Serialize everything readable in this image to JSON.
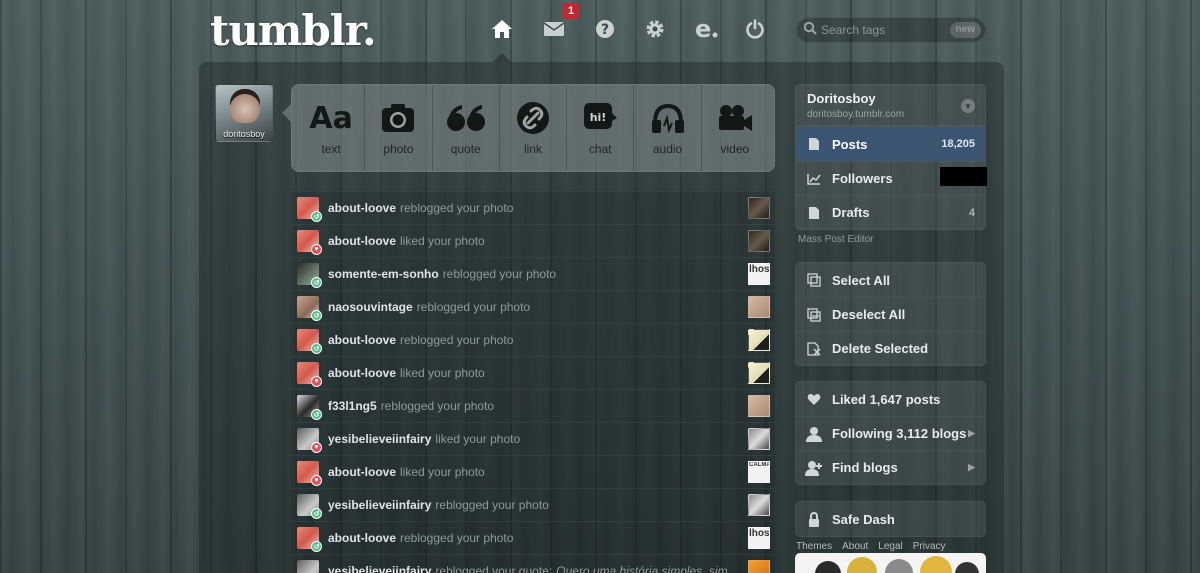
{
  "header": {
    "logo": "tumblr.",
    "mail_badge": "1",
    "search": {
      "placeholder": "Search tags",
      "new_label": "new"
    },
    "nav_icons": [
      "home-icon",
      "mail-icon",
      "help-icon",
      "gear-icon",
      "e-icon",
      "power-icon"
    ]
  },
  "profile": {
    "avatar_caption": "doritosboy"
  },
  "post_types": [
    {
      "label": "text",
      "glyph": "Aa"
    },
    {
      "label": "photo"
    },
    {
      "label": "quote",
      "glyph": "66"
    },
    {
      "label": "link"
    },
    {
      "label": "chat",
      "glyph": "hi!"
    },
    {
      "label": "audio"
    },
    {
      "label": "video"
    }
  ],
  "activity": [
    {
      "user": "about-loove",
      "action": "reblogged your photo",
      "type": "reblog"
    },
    {
      "user": "about-loove",
      "action": "liked your photo",
      "type": "like"
    },
    {
      "user": "somente-em-sonho",
      "action": "reblogged your photo",
      "type": "reblog",
      "thumb_text": "lhos"
    },
    {
      "user": "naosouvintage",
      "action": "reblogged your photo",
      "type": "reblog"
    },
    {
      "user": "about-loove",
      "action": "reblogged your photo",
      "type": "reblog"
    },
    {
      "user": "about-loove",
      "action": "liked your photo",
      "type": "like"
    },
    {
      "user": "f33l1ng5",
      "action": "reblogged your photo",
      "type": "reblog"
    },
    {
      "user": "yesibelieveiinfairy",
      "action": "liked your photo",
      "type": "like"
    },
    {
      "user": "about-loove",
      "action": "liked your photo",
      "type": "like",
      "thumb_text": "CALMA"
    },
    {
      "user": "yesibelieveiinfairy",
      "action": "reblogged your photo",
      "type": "reblog"
    },
    {
      "user": "about-loove",
      "action": "reblogged your photo",
      "type": "reblog",
      "thumb_text": "lhos"
    },
    {
      "user": "yesibelieveiinfairy",
      "action": "reblogged your quote:",
      "quote": "Quero uma história simples, sim",
      "type": "reblog"
    }
  ],
  "sidebar": {
    "blog": {
      "name": "Doritosboy",
      "url": "doritosboy.tumblr.com"
    },
    "stats": [
      {
        "label": "Posts",
        "count": "18,205",
        "icon": "document-icon",
        "active": true
      },
      {
        "label": "Followers",
        "count": "",
        "icon": "chart-icon"
      },
      {
        "label": "Drafts",
        "count": "4",
        "icon": "document-icon"
      }
    ],
    "mass_editor": "Mass Post Editor",
    "mass_actions": [
      {
        "label": "Select All",
        "icon": "select-all-icon"
      },
      {
        "label": "Deselect All",
        "icon": "deselect-all-icon"
      },
      {
        "label": "Delete Selected",
        "icon": "delete-icon"
      }
    ],
    "social": [
      {
        "label": "Liked 1,647 posts",
        "icon": "heart-icon"
      },
      {
        "label": "Following 3,112 blogs",
        "icon": "person-icon"
      },
      {
        "label": "Find blogs",
        "icon": "add-person-icon"
      }
    ],
    "safe_dash": "Safe Dash",
    "footer": [
      "Themes",
      "About",
      "Legal",
      "Privacy"
    ]
  },
  "colors": {
    "active_blue": "#3b5472",
    "reblog_green": "#56bc8a",
    "like_red": "#e04f5f",
    "badge_red": "#c6262e"
  }
}
